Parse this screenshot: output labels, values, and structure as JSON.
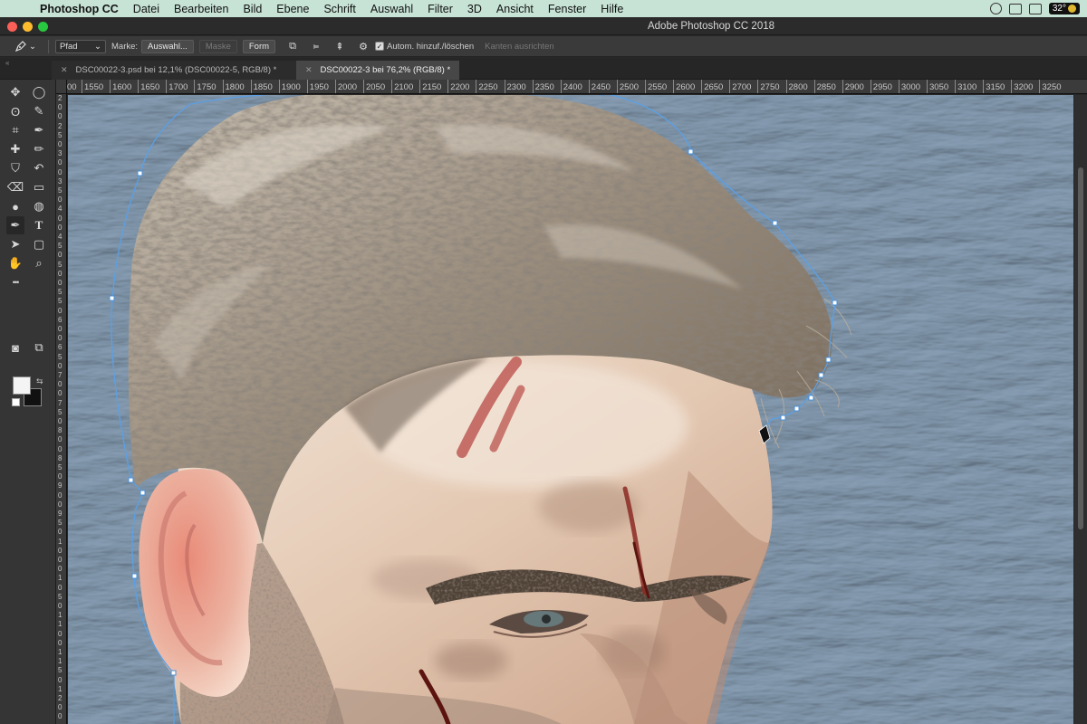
{
  "menubar": {
    "app_name": "Photoshop CC",
    "items": [
      "Datei",
      "Bearbeiten",
      "Bild",
      "Ebene",
      "Schrift",
      "Auswahl",
      "Filter",
      "3D",
      "Ansicht",
      "Fenster",
      "Hilfe"
    ],
    "temperature": "32°"
  },
  "window": {
    "title": "Adobe Photoshop CC 2018"
  },
  "options_bar": {
    "mode_value": "Pfad",
    "make_label": "Marke:",
    "selection_button": "Auswahl...",
    "mask_button": "Maske",
    "shape_button": "Form",
    "auto_add_delete_label": "Autom. hinzuf./löschen",
    "auto_add_delete_checked": true,
    "align_edges_label": "Kanten ausrichten"
  },
  "tabs": [
    {
      "label": "DSC00022-3.psd bei 12,1% (DSC00022-5, RGB/8) *",
      "active": false
    },
    {
      "label": "DSC00022-3 bei 76,2% (RGB/8) *",
      "active": true
    }
  ],
  "ruler_top": [
    "00",
    "1550",
    "1600",
    "1650",
    "1700",
    "1750",
    "1800",
    "1850",
    "1900",
    "1950",
    "2000",
    "2050",
    "2100",
    "2150",
    "2200",
    "2250",
    "2300",
    "2350",
    "2400",
    "2450",
    "2500",
    "2550",
    "2600",
    "2650",
    "2700",
    "2750",
    "2800",
    "2850",
    "2900",
    "2950",
    "3000",
    "3050",
    "3100",
    "3150",
    "3200",
    "3250"
  ],
  "ruler_left": [
    "2",
    "0",
    "0",
    "2",
    "5",
    "0",
    "3",
    "0",
    "0",
    "3",
    "5",
    "0",
    "4",
    "0",
    "0",
    "4",
    "5",
    "0",
    "5",
    "0",
    "0",
    "5",
    "5",
    "0",
    "6",
    "0",
    "0",
    "6",
    "5",
    "0",
    "7",
    "0",
    "0",
    "7",
    "5",
    "0",
    "8",
    "0",
    "0",
    "8",
    "5",
    "0",
    "9",
    "0",
    "0",
    "9",
    "5",
    "0",
    "1",
    "0",
    "0",
    "0",
    "1",
    "0",
    "5",
    "0",
    "1",
    "1",
    "0",
    "0",
    "1",
    "1",
    "5",
    "0",
    "1",
    "2",
    "0",
    "0"
  ],
  "tools": [
    {
      "name": "move-tool",
      "glyph": "✥"
    },
    {
      "name": "elliptical-marquee-tool",
      "glyph": "◯"
    },
    {
      "name": "lasso-tool",
      "glyph": "ʘ"
    },
    {
      "name": "quick-selection-tool",
      "glyph": "✎"
    },
    {
      "name": "crop-tool",
      "glyph": "⌗"
    },
    {
      "name": "eyedropper-tool",
      "glyph": "✒"
    },
    {
      "name": "healing-brush-tool",
      "glyph": "✚"
    },
    {
      "name": "brush-tool",
      "glyph": "✏"
    },
    {
      "name": "clone-stamp-tool",
      "glyph": "⛉"
    },
    {
      "name": "history-brush-tool",
      "glyph": "↶"
    },
    {
      "name": "eraser-tool",
      "glyph": "⌫"
    },
    {
      "name": "gradient-tool",
      "glyph": "▭"
    },
    {
      "name": "blur-tool",
      "glyph": "●"
    },
    {
      "name": "dodge-tool",
      "glyph": "◍"
    },
    {
      "name": "pen-tool",
      "glyph": "✒"
    },
    {
      "name": "type-tool",
      "glyph": "T"
    },
    {
      "name": "path-selection-tool",
      "glyph": "➤"
    },
    {
      "name": "rectangle-tool",
      "glyph": "▢"
    },
    {
      "name": "hand-tool",
      "glyph": "✋"
    },
    {
      "name": "zoom-tool",
      "glyph": "⌕"
    },
    {
      "name": "more-tools",
      "glyph": "•••"
    }
  ],
  "colors": {
    "foreground": "#f4f4f4",
    "background": "#111111",
    "accent": "#5aa0e6"
  }
}
